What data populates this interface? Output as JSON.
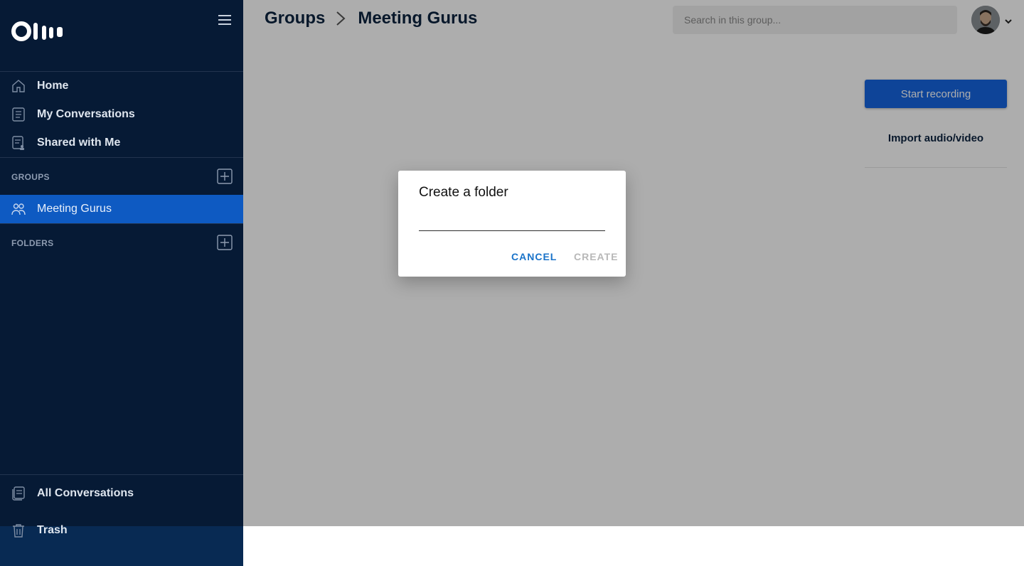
{
  "app": {
    "brand": "Otter"
  },
  "colors": {
    "sidebar": "#061a35",
    "accent": "#1565e0",
    "active_nav": "#0e5ac2"
  },
  "sidebar": {
    "nav": [
      {
        "label": "Home",
        "icon": "home-icon"
      },
      {
        "label": "My Conversations",
        "icon": "document-icon"
      },
      {
        "label": "Shared with Me",
        "icon": "shared-document-icon"
      }
    ],
    "groups_title": "GROUPS",
    "groups": [
      {
        "label": "Meeting Gurus",
        "icon": "people-icon",
        "active": true
      }
    ],
    "folders_title": "FOLDERS",
    "all_conversations": "All Conversations",
    "trash": "Trash"
  },
  "header": {
    "breadcrumb": [
      "Groups",
      "Meeting Gurus"
    ],
    "search_placeholder": "Search in this group..."
  },
  "actions": {
    "start_recording": "Start recording",
    "import": "Import audio/video"
  },
  "dialog": {
    "title": "Create a folder",
    "input_value": "",
    "cancel": "CANCEL",
    "create": "CREATE"
  }
}
